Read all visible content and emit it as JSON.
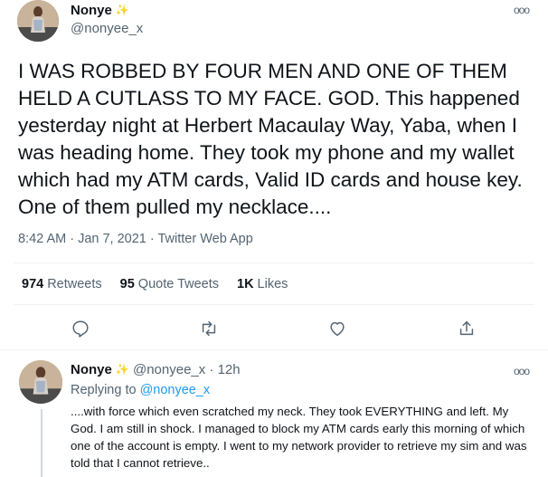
{
  "tweet": {
    "name": "Nonye",
    "handle": "@nonyee_x",
    "text": "I WAS ROBBED BY FOUR MEN AND ONE OF THEM HELD A CUTLASS TO MY FACE. GOD. This happened yesterday night at Herbert Macaulay Way, Yaba, when I was heading home. They took my phone and my wallet which had my ATM cards, Valid ID cards and house key. One of them pulled my necklace....",
    "timestamp": "8:42 AM · Jan 7, 2021 · Twitter Web App",
    "stats": {
      "retweets_count": "974",
      "retweets_label": "Retweets",
      "quotes_count": "95",
      "quotes_label": "Quote Tweets",
      "likes_count": "1K",
      "likes_label": "Likes"
    },
    "more_glyph": "ooo",
    "badge_glyph": "✨"
  },
  "reply": {
    "name": "Nonye",
    "handle": "@nonyee_x",
    "separator": "·",
    "time": "12h",
    "replying_prefix": "Replying to",
    "replying_to": "@nonyee_x",
    "text": "....with force which even scratched my neck. They took EVERYTHING and left. My God. I am still in shock. I managed to block my ATM cards early this morning of which one of the account is empty. I went to my network provider to retrieve my sim and was told that I cannot retrieve..",
    "more_glyph": "ooo",
    "badge_glyph": "✨"
  },
  "icons": [
    "reply-icon",
    "retweet-icon",
    "like-icon",
    "share-icon"
  ],
  "colors": {
    "link": "#1d9bf0",
    "muted": "#536471",
    "text": "#0f1419",
    "divider": "#eff3f4"
  }
}
